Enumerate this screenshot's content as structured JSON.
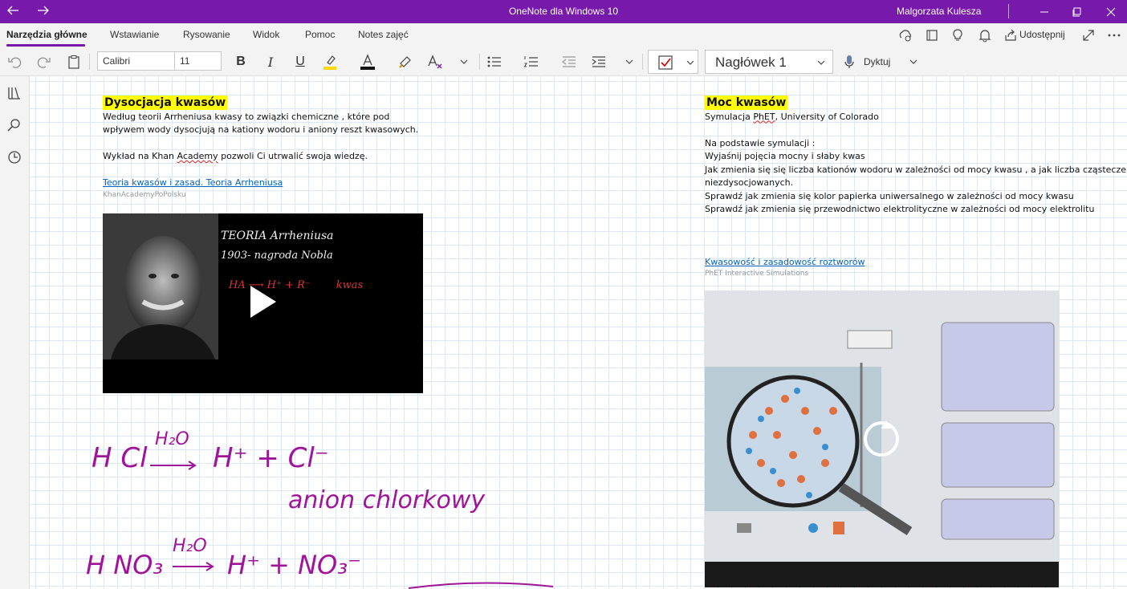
{
  "titlebar": {
    "back_icon": "back-arrow-icon",
    "forward_icon": "forward-arrow-icon",
    "title": "OneNote dla Windows 10",
    "user": "Malgorzata Kulesza"
  },
  "tabs": [
    "Narzędzia główne",
    "Wstawianie",
    "Rysowanie",
    "Widok",
    "Pomoc",
    "Notes zajęć"
  ],
  "active_tab": "Narzędzia główne",
  "share_label": "Udostępnij",
  "toolbar": {
    "font_name": "Calibri",
    "font_size": "11",
    "bold": "B",
    "italic": "I",
    "underline": "U",
    "style": "Nagłówek 1",
    "dictate": "Dyktuj",
    "highlight_color": "#ffd800",
    "font_color": "#111111"
  },
  "left_note": {
    "title": "Dysocjacja kwasów",
    "line1": "Według teorii Arrheniusa kwasy to związki chemiczne , które pod",
    "line2": "wpływem wody dysocjują na kationy wodoru i aniony reszt kwasowych.",
    "line3_a": "Wykład na Khan ",
    "line3_b": "Academy",
    "line3_c": " pozwoli Ci utrwalić swoja wiedzę.",
    "link": "Teoria kwasów i zasad. Teoria Arrheniusa",
    "source": "KhanAcademyPoPolsku",
    "video_board_line1": "TEORIA Arrheniusa",
    "video_board_line2": "1903- nagroda Nobla",
    "video_board_line3": "HA ⟶ H⁺ + R⁻",
    "video_board_line3_suffix": "kwas"
  },
  "right_note": {
    "title": "Moc kwasów",
    "line1_a": "Symulacja ",
    "line1_b": "PhET",
    "line1_c": ", University of Colorado",
    "line2": "Na podstawie symulacji :",
    "line3": "Wyjaśnij pojęcia mocny i słaby kwas",
    "line4": "Jak zmienia się się liczba kationów wodoru w zależności od mocy kwasu , a jak liczba cząsteczek",
    "line5": "niezdysocjowanych.",
    "line6": "Sprawdź jak zmienia się kolor papierka uniwersalnego w zależności od mocy kwasu",
    "line7": "Sprawdź jak zmienia się przewodnictwo elektrolityczne w zależności od mocy elektrolitu",
    "link": "Kwasowość i zasadowość roztworów",
    "source": "PhET Interactive Simulations"
  },
  "ink": {
    "eq1_left": "H Cl",
    "eq1_over": "H₂O",
    "eq1_right": "H⁺ + Cl⁻",
    "eq1_note": "anion chlorkowy",
    "eq2_left": "H NO₃",
    "eq2_over": "H₂O",
    "eq2_right": "H⁺ + NO₃⁻"
  }
}
